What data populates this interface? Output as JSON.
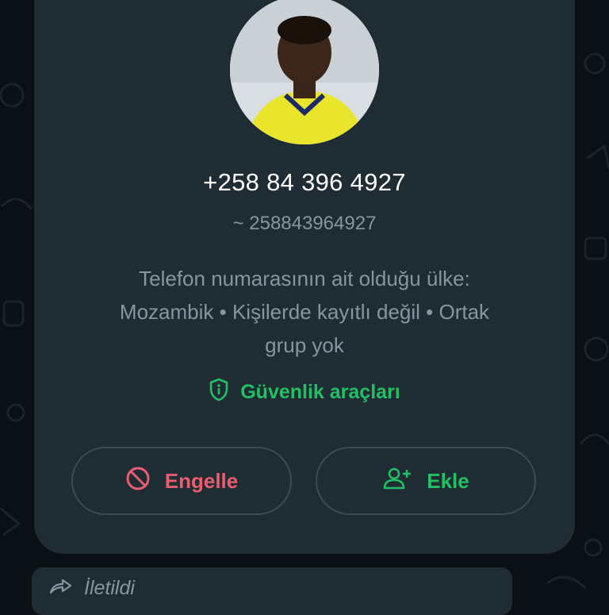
{
  "contact": {
    "phone": "+258 84 396 4927",
    "pushname": "~ 258843964927",
    "info_line1": "Telefon numarasının ait olduğu ülke:",
    "info_line2": "Mozambik • Kişilerde kayıtlı değil • Ortak",
    "info_line3": "grup yok"
  },
  "safety": {
    "label": "Güvenlik araçları",
    "icon": "shield-icon"
  },
  "actions": {
    "block_label": "Engelle",
    "add_label": "Ekle"
  },
  "message": {
    "forwarded_label": "İletildi"
  },
  "colors": {
    "card": "#1f2c34",
    "background": "#0b1014",
    "accent_green": "#21c063",
    "danger": "#ea5d6f",
    "secondary_text": "#8696a0"
  }
}
